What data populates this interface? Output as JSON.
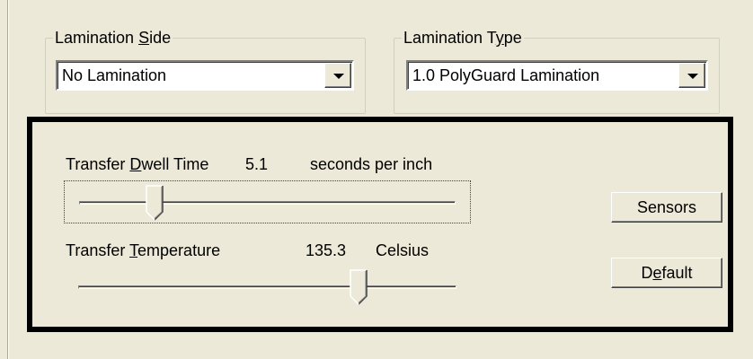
{
  "lamination_side": {
    "legend_prefix": "Lamination ",
    "legend_mnemonic": "S",
    "legend_suffix": "ide",
    "selected": "No Lamination"
  },
  "lamination_type": {
    "legend_prefix": "Lamination T",
    "legend_mnemonic": "y",
    "legend_suffix": "pe",
    "selected": "1.0 PolyGuard Lamination"
  },
  "dwell_time": {
    "label_prefix": "Transfer ",
    "label_mnemonic": "D",
    "label_suffix": "well Time",
    "value": "5.1",
    "unit": "seconds per inch",
    "slider_fraction": 0.2
  },
  "temperature": {
    "label_prefix": "Transfer ",
    "label_mnemonic": "T",
    "label_suffix": "emperature",
    "value": "135.3",
    "unit": "Celsius",
    "slider_fraction": 0.74
  },
  "buttons": {
    "sensors_label": "Sensors",
    "default_prefix": "D",
    "default_mnemonic": "e",
    "default_suffix": "fault"
  },
  "colors": {
    "panel_background": "#ece9d8",
    "highlight_border": "#000000"
  }
}
